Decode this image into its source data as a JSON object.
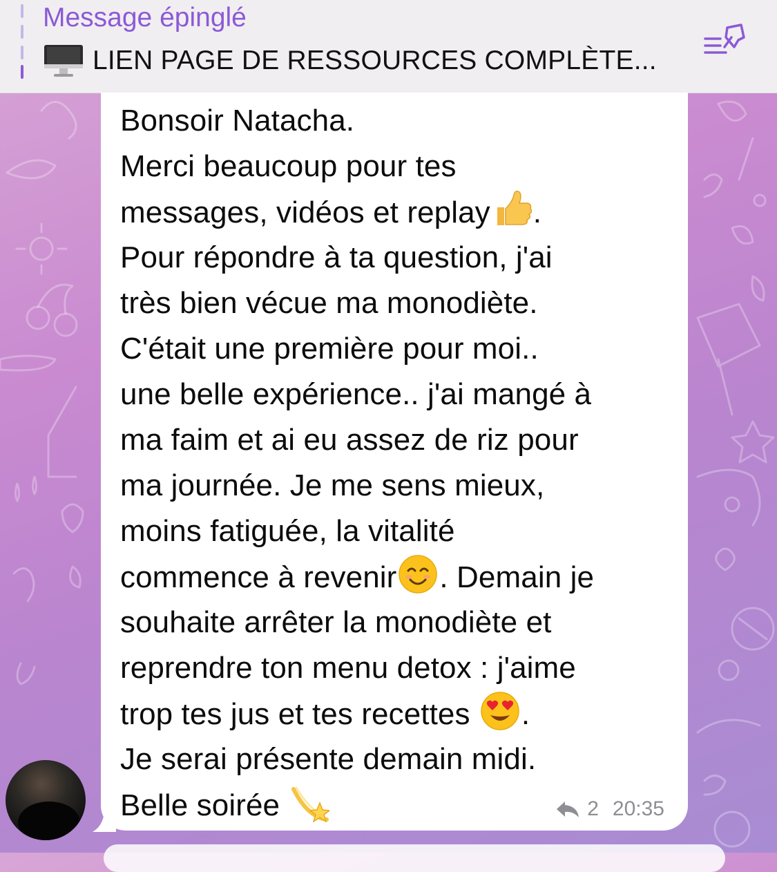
{
  "pinned": {
    "title": "Message épinglé",
    "icon": "desktop-computer-icon",
    "text": "LIEN PAGE DE RESSOURCES COMPLÈTE..."
  },
  "message": {
    "lines": [
      "Bonsoir Natacha.",
      "Merci beaucoup pour tes",
      "messages, vidéos et replay",
      "Pour répondre à ta question, j'ai",
      "très bien vécue ma monodiète.",
      "C'était une première pour moi..",
      "une belle expérience.. j'ai mangé à",
      "ma faim et ai eu assez de riz pour",
      "ma journée. Je me sens mieux,",
      "moins fatiguée, la vitalité",
      "commence à revenir",
      "souhaite arrêter la monodiète et",
      "reprendre ton menu detox : j'aime",
      "trop tes jus et tes recettes ",
      "Je serai présente demain midi.",
      "Belle soirée "
    ],
    "line_suffixes": {
      "line3": ".",
      "line11": ". Demain je",
      "line14": "."
    },
    "emojis": [
      "thumbs-up",
      "smiling-face",
      "heart-eyes-face",
      "dizzy-star"
    ],
    "reply_count": "2",
    "time": "20:35"
  },
  "colors": {
    "accent": "#8b5ad6",
    "bubble": "#ffffff",
    "meta": "#8e8e93"
  }
}
